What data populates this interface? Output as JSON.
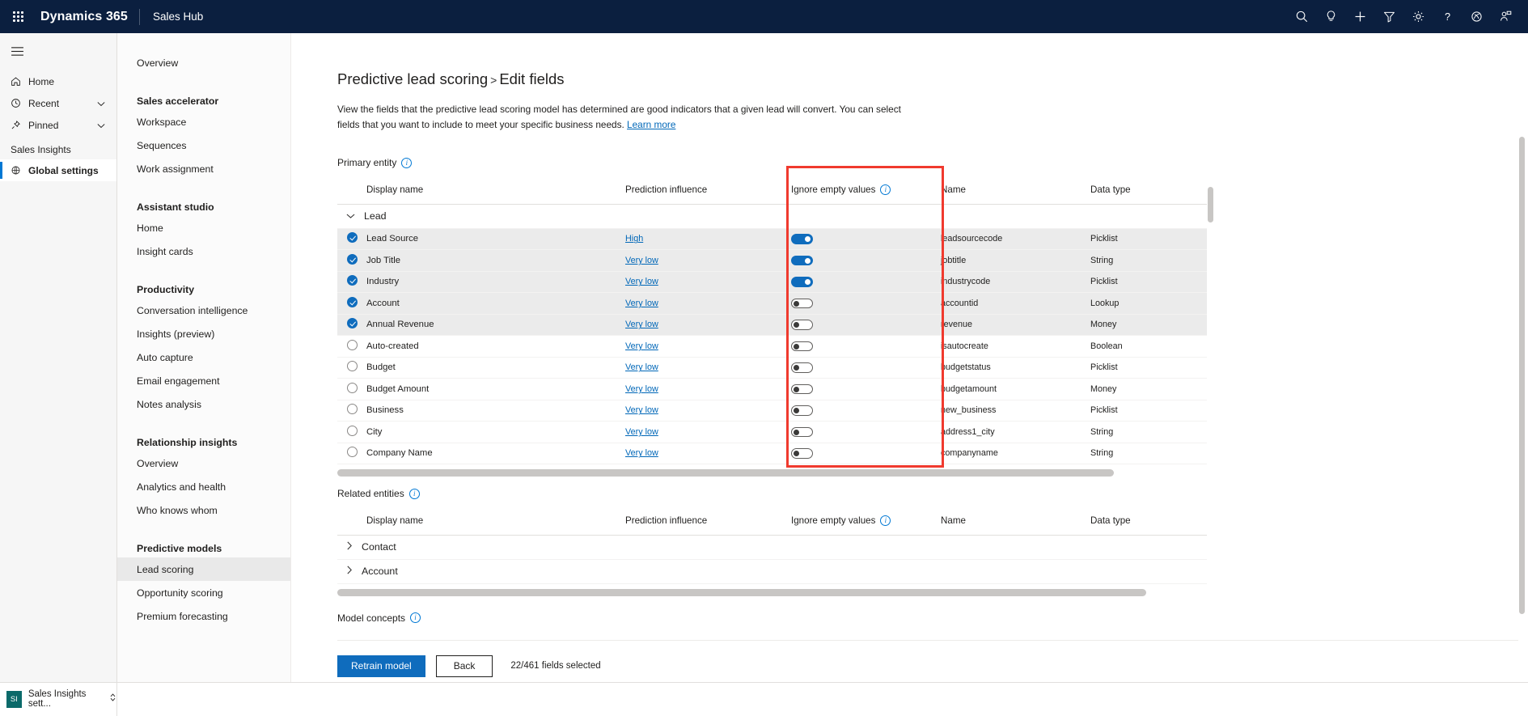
{
  "topbar": {
    "waffle_label": "app-launcher",
    "brand": "Dynamics 365",
    "app_title": "Sales Hub",
    "icons": [
      {
        "name": "search-icon",
        "label": "Search"
      },
      {
        "name": "lightbulb-icon",
        "label": "Insights"
      },
      {
        "name": "plus-icon",
        "label": "New"
      },
      {
        "name": "filter-icon",
        "label": "Filter"
      },
      {
        "name": "gear-icon",
        "label": "Settings"
      },
      {
        "name": "help-icon",
        "label": "Help"
      },
      {
        "name": "assistant-icon",
        "label": "Assistant"
      },
      {
        "name": "user-profile-icon",
        "label": "Profile"
      }
    ]
  },
  "leftnav": {
    "hamburger_label": "Show more",
    "items": [
      {
        "label": "Home",
        "icon": "home-icon",
        "expandable": false
      },
      {
        "label": "Recent",
        "icon": "clock-icon",
        "expandable": true
      },
      {
        "label": "Pinned",
        "icon": "pin-icon",
        "expandable": true
      }
    ],
    "group_title": "Sales Insights",
    "selected_item": {
      "label": "Global settings",
      "icon": "globe-settings-icon"
    }
  },
  "secondnav": {
    "top_link": "Overview",
    "sections": [
      {
        "heading": "Sales accelerator",
        "links": [
          "Workspace",
          "Sequences",
          "Work assignment"
        ]
      },
      {
        "heading": "Assistant studio",
        "links": [
          "Home",
          "Insight cards"
        ]
      },
      {
        "heading": "Productivity",
        "links": [
          "Conversation intelligence",
          "Insights (preview)",
          "Auto capture",
          "Email engagement",
          "Notes analysis"
        ]
      },
      {
        "heading": "Relationship insights",
        "links": [
          "Overview",
          "Analytics and health",
          "Who knows whom"
        ]
      },
      {
        "heading": "Predictive models",
        "links": [
          "Lead scoring",
          "Opportunity scoring",
          "Premium forecasting"
        ]
      }
    ],
    "active_link": "Lead scoring"
  },
  "page": {
    "breadcrumb_parent": "Predictive lead scoring",
    "breadcrumb_separator": ">",
    "breadcrumb_current": "Edit fields",
    "description": "View the fields that the predictive lead scoring model has determined are good indicators that a given lead will convert. You can select fields that you want to include to meet your specific business needs.",
    "learn_more": "Learn more"
  },
  "primary_entity": {
    "section_label": "Primary entity",
    "info_icon": "info-icon",
    "columns": [
      "Display name",
      "Prediction influence",
      "Ignore empty values",
      "Name",
      "Data type"
    ],
    "group": {
      "label": "Lead",
      "expanded": true,
      "chevron": "chevron-down-icon"
    },
    "rows": [
      {
        "selected": true,
        "display_name": "Lead Source",
        "influence": "High",
        "ignore_empty": true,
        "name": "leadsourcecode",
        "data_type": "Picklist"
      },
      {
        "selected": true,
        "display_name": "Job Title",
        "influence": "Very low",
        "ignore_empty": true,
        "name": "jobtitle",
        "data_type": "String"
      },
      {
        "selected": true,
        "display_name": "Industry",
        "influence": "Very low",
        "ignore_empty": true,
        "name": "industrycode",
        "data_type": "Picklist"
      },
      {
        "selected": true,
        "display_name": "Account",
        "influence": "Very low",
        "ignore_empty": false,
        "name": "accountid",
        "data_type": "Lookup"
      },
      {
        "selected": true,
        "display_name": "Annual Revenue",
        "influence": "Very low",
        "ignore_empty": false,
        "name": "revenue",
        "data_type": "Money"
      },
      {
        "selected": false,
        "display_name": "Auto-created",
        "influence": "Very low",
        "ignore_empty": false,
        "name": "isautocreate",
        "data_type": "Boolean"
      },
      {
        "selected": false,
        "display_name": "Budget",
        "influence": "Very low",
        "ignore_empty": false,
        "name": "budgetstatus",
        "data_type": "Picklist"
      },
      {
        "selected": false,
        "display_name": "Budget Amount",
        "influence": "Very low",
        "ignore_empty": false,
        "name": "budgetamount",
        "data_type": "Money"
      },
      {
        "selected": false,
        "display_name": "Business",
        "influence": "Very low",
        "ignore_empty": false,
        "name": "new_business",
        "data_type": "Picklist"
      },
      {
        "selected": false,
        "display_name": "City",
        "influence": "Very low",
        "ignore_empty": false,
        "name": "address1_city",
        "data_type": "String"
      },
      {
        "selected": false,
        "display_name": "Company Name",
        "influence": "Very low",
        "ignore_empty": false,
        "name": "companyname",
        "data_type": "String"
      }
    ]
  },
  "related_entities": {
    "section_label": "Related entities",
    "info_icon": "info-icon",
    "columns": [
      "Display name",
      "Prediction influence",
      "Ignore empty values",
      "Name",
      "Data type"
    ],
    "groups": [
      {
        "label": "Contact",
        "expanded": false,
        "chevron": "chevron-right-icon"
      },
      {
        "label": "Account",
        "expanded": false,
        "chevron": "chevron-right-icon"
      }
    ]
  },
  "model_concepts": {
    "section_label": "Model concepts",
    "info_icon": "info-icon"
  },
  "footer": {
    "primary_button": "Retrain model",
    "secondary_button": "Back",
    "field_count": "22/461 fields selected"
  },
  "statusbar": {
    "badge": "SI",
    "label": "Sales Insights sett...",
    "chevron": "chevron-updown-icon"
  },
  "annotation": {
    "type": "red-highlight-rectangle",
    "target_column": "Ignore empty values"
  },
  "colors": {
    "topbar_bg": "#0b1f3f",
    "accent": "#0f6cbd",
    "link": "#0067b8",
    "annotation_red": "#f03a2e",
    "row_selected_bg": "#ebebeb",
    "badge_teal": "#0b6a6a"
  }
}
